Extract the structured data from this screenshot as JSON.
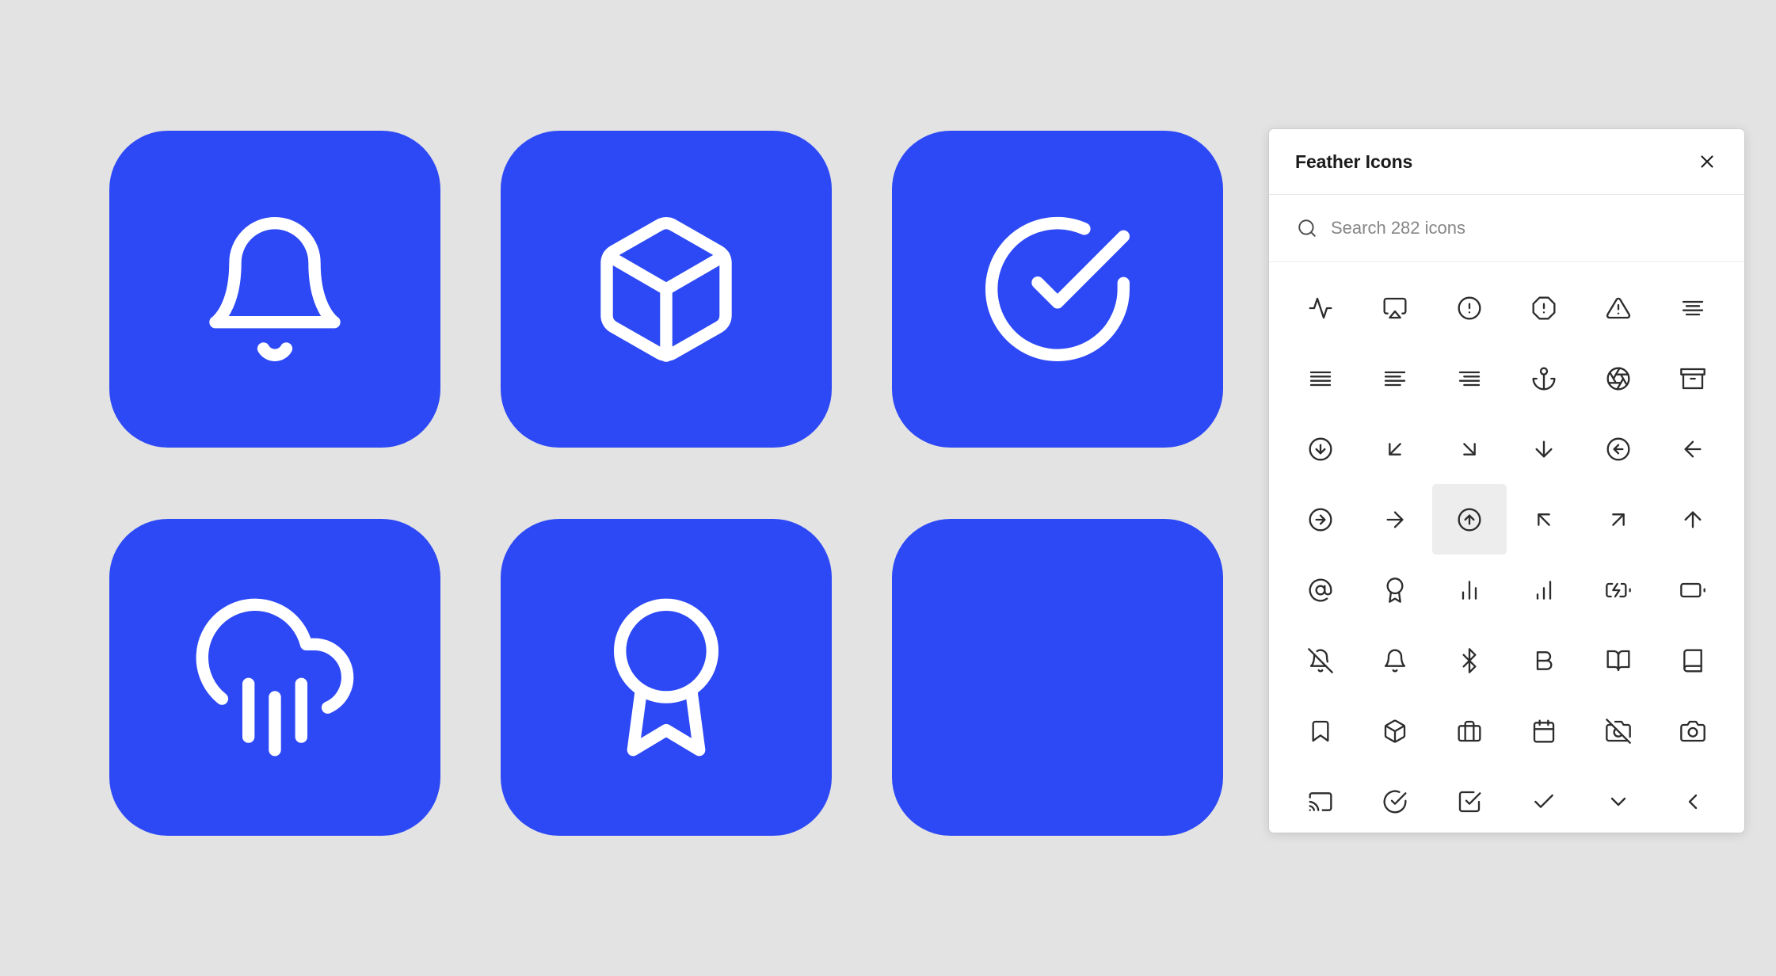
{
  "canvas": {
    "background_color": "#e3e3e3",
    "tile_color": "#2d49f5",
    "tile_icon_color": "#ffffff",
    "tiles": [
      {
        "icon": "bell-icon",
        "label": "bell"
      },
      {
        "icon": "box-icon",
        "label": "box"
      },
      {
        "icon": "check-circle-icon",
        "label": "check-circle"
      },
      {
        "icon": "cloud-rain-icon",
        "label": "cloud-drizzle"
      },
      {
        "icon": "award-icon",
        "label": "award"
      },
      {
        "icon": "empty-icon",
        "label": ""
      }
    ]
  },
  "icon_picker": {
    "title": "Feather Icons",
    "close_label": "✕",
    "close_icon": "close-icon",
    "search": {
      "placeholder": "Search 282 icons",
      "value": "",
      "icon": "search-icon",
      "icon_count": 282
    },
    "active_icon": "arrow-up-circle",
    "highlight_color": "#ededed",
    "grid": [
      {
        "name": "activity",
        "active": false
      },
      {
        "name": "airplay",
        "active": false
      },
      {
        "name": "alert-circle",
        "active": false
      },
      {
        "name": "alert-octagon",
        "active": false
      },
      {
        "name": "alert-triangle",
        "active": false
      },
      {
        "name": "align-center",
        "active": false
      },
      {
        "name": "align-justify",
        "active": false
      },
      {
        "name": "align-left",
        "active": false
      },
      {
        "name": "align-right",
        "active": false
      },
      {
        "name": "anchor",
        "active": false
      },
      {
        "name": "aperture",
        "active": false
      },
      {
        "name": "archive",
        "active": false
      },
      {
        "name": "arrow-down-circle",
        "active": false
      },
      {
        "name": "arrow-down-left",
        "active": false
      },
      {
        "name": "arrow-down-right",
        "active": false
      },
      {
        "name": "arrow-down",
        "active": false
      },
      {
        "name": "arrow-left-circle",
        "active": false
      },
      {
        "name": "arrow-left",
        "active": false
      },
      {
        "name": "arrow-right-circle",
        "active": false
      },
      {
        "name": "arrow-right",
        "active": false
      },
      {
        "name": "arrow-up-circle",
        "active": true
      },
      {
        "name": "arrow-up-left",
        "active": false
      },
      {
        "name": "arrow-up-right",
        "active": false
      },
      {
        "name": "arrow-up",
        "active": false
      },
      {
        "name": "at-sign",
        "active": false
      },
      {
        "name": "award",
        "active": false
      },
      {
        "name": "bar-chart-2",
        "active": false
      },
      {
        "name": "bar-chart",
        "active": false
      },
      {
        "name": "battery-charging",
        "active": false
      },
      {
        "name": "battery",
        "active": false
      },
      {
        "name": "bell-off",
        "active": false
      },
      {
        "name": "bell",
        "active": false
      },
      {
        "name": "bluetooth",
        "active": false
      },
      {
        "name": "bold",
        "active": false
      },
      {
        "name": "book-open",
        "active": false
      },
      {
        "name": "book",
        "active": false
      },
      {
        "name": "bookmark",
        "active": false
      },
      {
        "name": "box",
        "active": false
      },
      {
        "name": "briefcase",
        "active": false
      },
      {
        "name": "calendar",
        "active": false
      },
      {
        "name": "camera-off",
        "active": false
      },
      {
        "name": "camera",
        "active": false
      },
      {
        "name": "cast",
        "active": false
      },
      {
        "name": "check-circle",
        "active": false
      },
      {
        "name": "check-square",
        "active": false
      },
      {
        "name": "check",
        "active": false
      },
      {
        "name": "chevron-down",
        "active": false
      },
      {
        "name": "chevron-left",
        "active": false
      }
    ]
  }
}
